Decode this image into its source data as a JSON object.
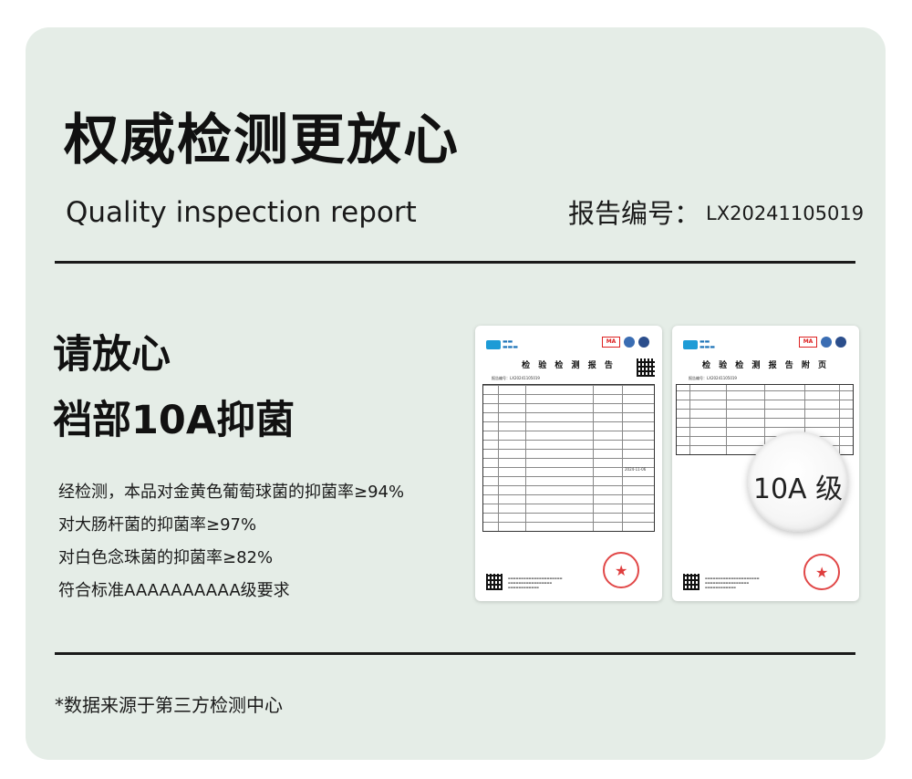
{
  "title": "权威检测更放心",
  "subtitle": "Quality inspection report",
  "report_number": {
    "label": "报告编号：",
    "value": "LX20241105019"
  },
  "headline": {
    "line1": "请放心",
    "line2": "裆部10A抑菌"
  },
  "results": [
    "经检测，本品对金黄色葡萄球菌的抑菌率≥94%",
    "对大肠杆菌的抑菌率≥97%",
    "对白色念珠菌的抑菌率≥82%",
    "符合标准AAAAAAAAAA级要求"
  ],
  "report_page_1": {
    "title": "检 验 检 测 报 告",
    "cma": "MA",
    "report_no": "报告编号：LX20241105019",
    "date": "2024-11-06"
  },
  "report_page_2": {
    "title": "检 验 检 测 报 告 附 页",
    "cma": "MA",
    "report_no": "报告编号：LX20241105019"
  },
  "magnifier_text": "10A 级",
  "footnote": "*数据来源于第三方检测中心",
  "colors": {
    "card_bg": "#e5ede7",
    "text": "#111111",
    "stamp": "#dc2828"
  }
}
